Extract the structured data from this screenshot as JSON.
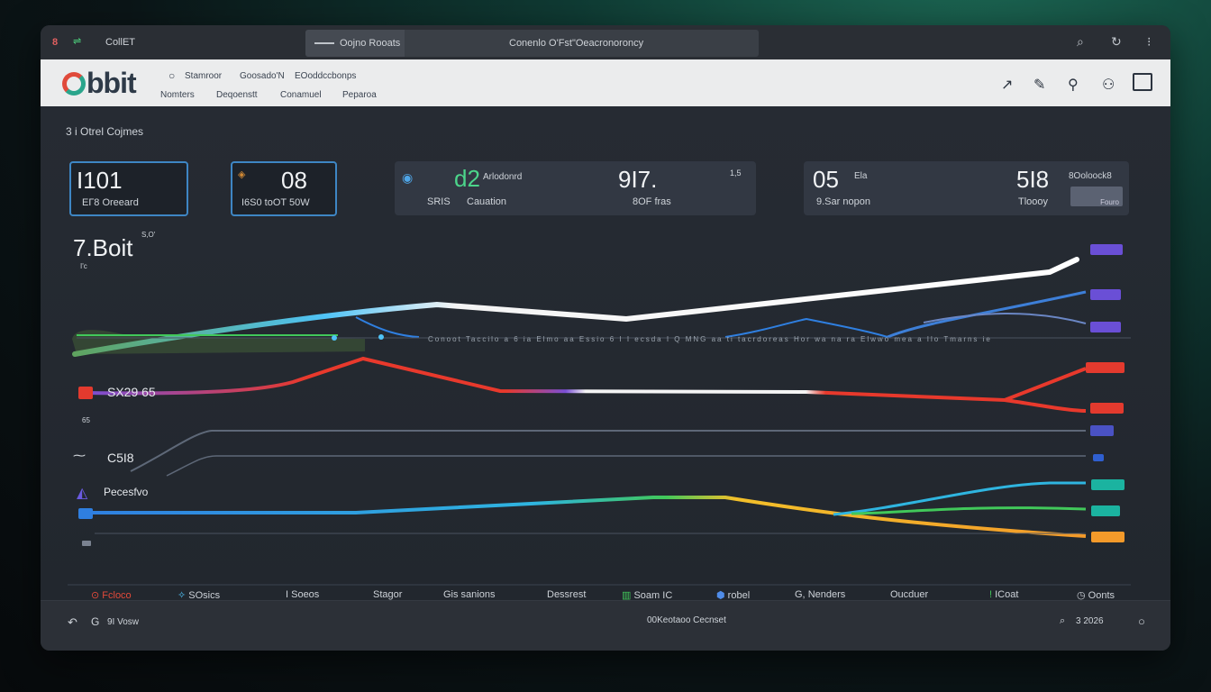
{
  "titlebar": {
    "app_badge": "8",
    "app_name": "CollET",
    "search_label": "Oojno Rooats",
    "search_text": "Conenlo O'Fst\"Oeacronoroncy",
    "icons": [
      "search-icon",
      "refresh-icon",
      "more-icon"
    ]
  },
  "header": {
    "logo_text": "bbit",
    "menu_top": [
      "Stamroor",
      "Goosado'N",
      "EOoddccbonps"
    ],
    "menu_bottom": [
      "Nomters",
      "Deqoenstt",
      "Conamuel",
      "Peparoa"
    ],
    "icons": [
      "trend-icon",
      "edit-icon",
      "link-icon",
      "user-icon",
      "window-icon"
    ]
  },
  "section_title": "3 i Otrel Cojmes",
  "cards": [
    {
      "value": "I101",
      "caption": "ЕГ8 Oreeard"
    },
    {
      "value": "08",
      "caption": "I6S0 toOT 50W"
    },
    {
      "value": "d2",
      "label": "Arlodonrd",
      "caption1": "SRIS",
      "caption2": "Cauation",
      "value2": "9I7.",
      "sub2": "1,5",
      "caption3": "8OF fras"
    },
    {
      "value": "05",
      "label": "Ela",
      "caption": "9.Sar nopon",
      "value2": "5I8",
      "label2": "8Ooloock8",
      "caption2": "Tloooy",
      "tag": "Fouro"
    }
  ],
  "big_stat": {
    "value": "7.Boit",
    "sup": "S,O'",
    "sub": "I'c"
  },
  "row_labels": {
    "series_a": "SX29 65",
    "series_a_sub": "65",
    "series_b": "C5I8",
    "series_c": "Pecesfvo"
  },
  "axis_strip": "Conoot Taccilo a 6 ia Elmo aa Essio 6 I I ecsda I Q MNG aa ti tacrdoreas Hor wa na ra Elwwo mea a Ilo Tmarns ie",
  "legend": [
    {
      "icon": "fire-icon",
      "label": "Fcloco"
    },
    {
      "icon": "flask-icon",
      "label": "SOsics"
    },
    {
      "icon": "",
      "label": "I Soeos"
    },
    {
      "icon": "",
      "label": "Stagor"
    },
    {
      "icon": "gear-icon",
      "label": "Gis sanions"
    },
    {
      "icon": "",
      "label": "Dessrest"
    },
    {
      "icon": "chart-icon",
      "label": "Soam IC"
    },
    {
      "icon": "rocket-icon",
      "label": "robel"
    },
    {
      "icon": "g-icon",
      "label": "Nenders"
    },
    {
      "icon": "",
      "label": "Oucduer"
    },
    {
      "icon": "bolt-icon",
      "label": "ICoat"
    },
    {
      "icon": "clock-icon",
      "label": "Oonts"
    }
  ],
  "footer": {
    "left_text": "9I Vosw",
    "center_text": "00Keotaoo Cecnset",
    "right_text": "3 2026",
    "icons": [
      "back-icon",
      "g-icon",
      "search-icon",
      "circle-icon"
    ]
  },
  "colors": {
    "white_line": "#f4f4f4",
    "cyan": "#4fc3f7",
    "red": "#e8392c",
    "purple": "#7b4fd6",
    "green": "#41c85a",
    "orange": "#f39a2a",
    "blue": "#2f7fe0",
    "tag_purple": "#6a4fd6",
    "tag_red": "#e33a2e",
    "tag_teal": "#1bb3a0"
  }
}
